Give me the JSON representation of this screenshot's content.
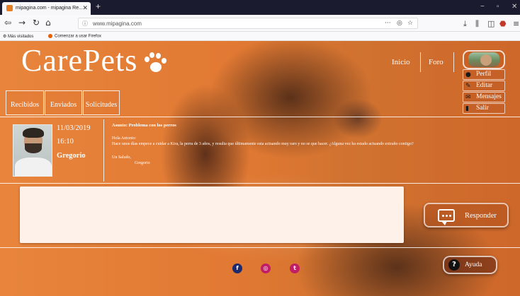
{
  "browser": {
    "tab_title": "mipagina.com - mipagina Re...",
    "url": "www.mipagina.com",
    "url_info_icon": "ⓘ",
    "more_icon": "···",
    "pocket_icon": "◎",
    "star_icon": "☆",
    "bookmarks": [
      {
        "label": "Más visitados"
      },
      {
        "label": "Comenzar a usar Firefox"
      }
    ]
  },
  "header": {
    "logo": "CarePets",
    "nav": [
      {
        "label": "Inicio"
      },
      {
        "label": "Foro"
      }
    ]
  },
  "user_menu": [
    {
      "label": "Perfil",
      "icon": "person-icon"
    },
    {
      "label": "Editar",
      "icon": "pencil-icon"
    },
    {
      "label": "Mensajes",
      "icon": "envelope-icon"
    },
    {
      "label": "Salir",
      "icon": "logout-icon"
    }
  ],
  "tabs": [
    {
      "label": "Recibidos"
    },
    {
      "label": "Enviados"
    },
    {
      "label": "Solicitudes"
    }
  ],
  "message": {
    "date": "11/03/2019",
    "time": "16:10",
    "sender": "Gregorio",
    "subject": "Asunto: Problema con los perros",
    "greeting": "Hola Antonio:",
    "body": "Hace unos días empece a cuidar a Kira, la perra de 3 años, y resulta que últimamente esta actuando muy raro y no se que hacer. ¿Alguna vez ha estado actuando extraño contigo?",
    "closing": "Un Saludo,",
    "signature": "Gregorio"
  },
  "reply": {
    "button_label": "Responder",
    "placeholder": ""
  },
  "footer": {
    "social": [
      {
        "name": "facebook-icon",
        "glyph": "f",
        "color": "#1e2a6e"
      },
      {
        "name": "instagram-icon",
        "glyph": "◎",
        "color": "#c21e66"
      },
      {
        "name": "twitter-icon",
        "glyph": "t",
        "color": "#c21e66"
      }
    ],
    "help_label": "Ayuda"
  },
  "colors": {
    "accent": "#df7a33",
    "reply_bg": "#fdf1ea"
  }
}
